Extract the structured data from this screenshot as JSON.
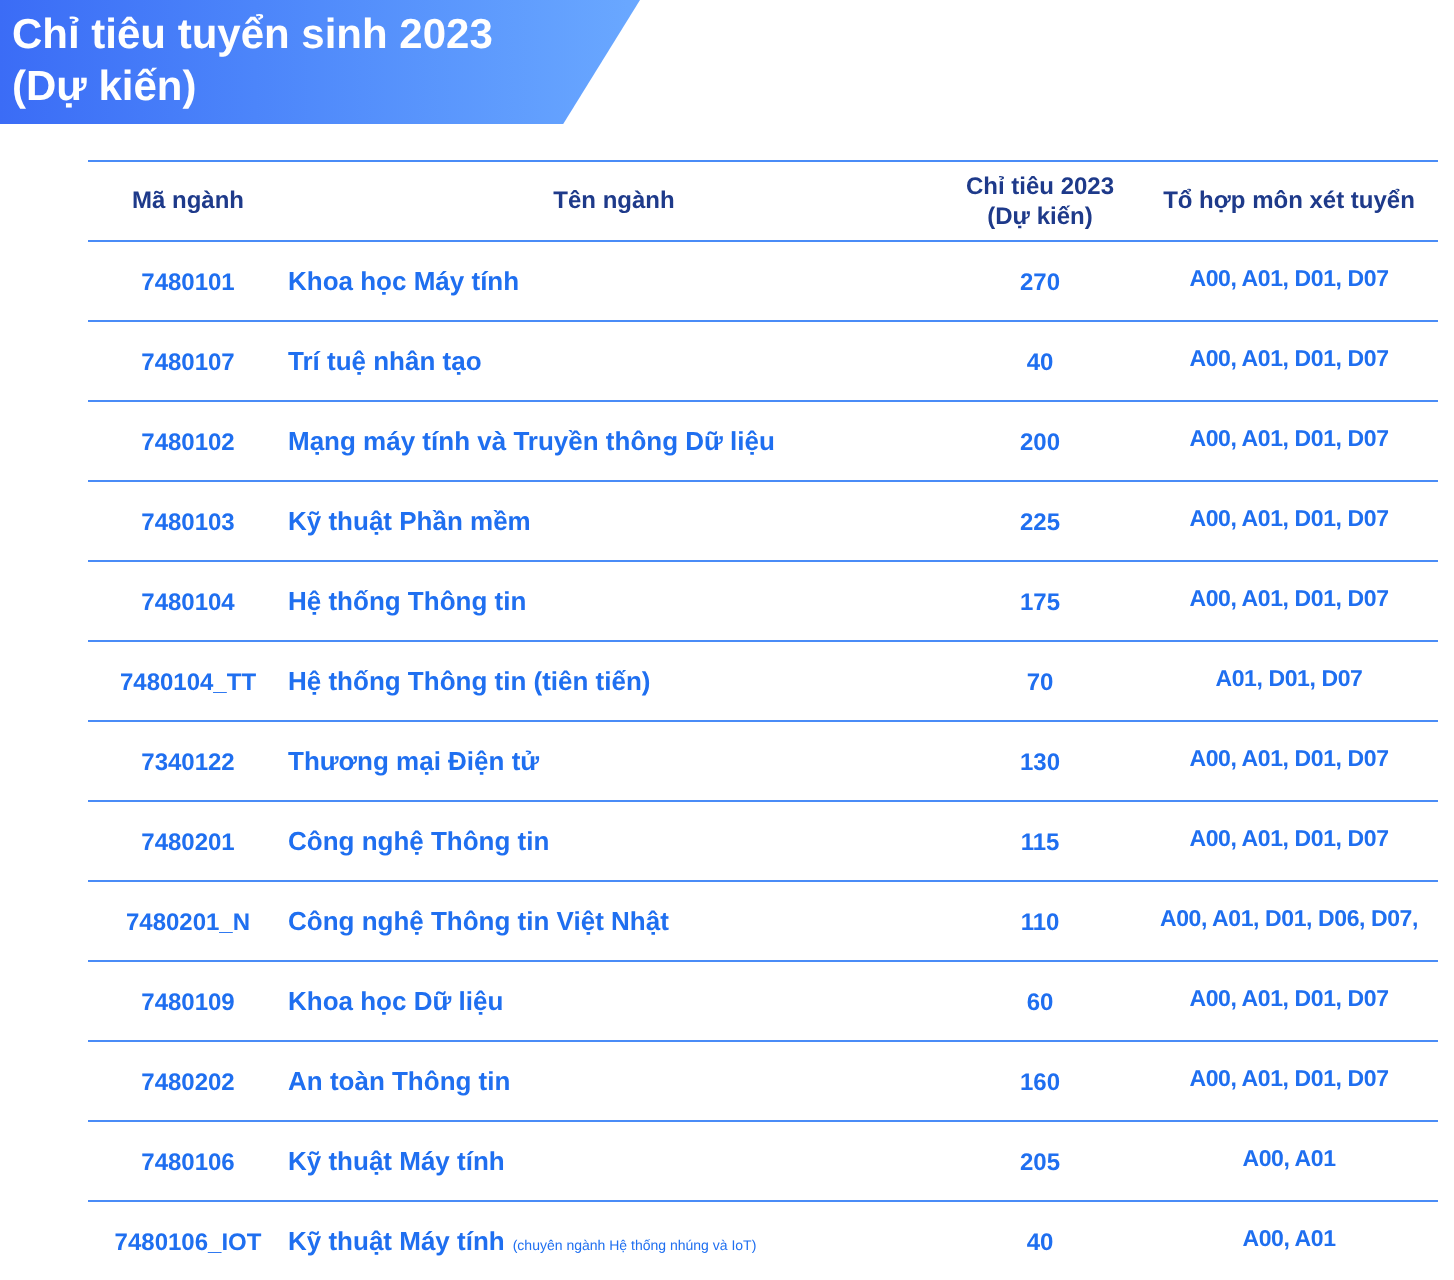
{
  "banner": {
    "title_lines": [
      "Chỉ tiêu tuyển sinh 2023",
      "(Dự kiến)"
    ]
  },
  "table": {
    "columns": [
      "Mã ngành",
      "Tên ngành",
      "Chỉ tiêu 2023\n(Dự kiến)",
      "Tổ hợp môn xét tuyển"
    ],
    "rows": [
      {
        "code": "7480101",
        "name": "Khoa học Máy tính",
        "quota": "270",
        "combos": "A00, A01, D01, D07"
      },
      {
        "code": "7480107",
        "name": "Trí tuệ nhân tạo",
        "quota": "40",
        "combos": "A00, A01, D01, D07"
      },
      {
        "code": "7480102",
        "name": "Mạng máy tính và Truyền thông Dữ liệu",
        "quota": "200",
        "combos": "A00, A01, D01, D07"
      },
      {
        "code": "7480103",
        "name": "Kỹ thuật Phần mềm",
        "quota": "225",
        "combos": "A00, A01, D01, D07"
      },
      {
        "code": "7480104",
        "name": "Hệ thống Thông tin",
        "quota": "175",
        "combos": "A00, A01, D01, D07"
      },
      {
        "code": "7480104_TT",
        "name": "Hệ thống Thông tin (tiên tiến)",
        "quota": "70",
        "combos": "A01, D01, D07"
      },
      {
        "code": "7340122",
        "name": "Thương mại Điện tử",
        "quota": "130",
        "combos": "A00, A01, D01, D07"
      },
      {
        "code": "7480201",
        "name": "Công nghệ Thông tin",
        "quota": "115",
        "combos": "A00, A01, D01, D07"
      },
      {
        "code": "7480201_N",
        "name": "Công nghệ Thông tin Việt Nhật",
        "quota": "110",
        "combos": "A00, A01, D01, D06, D07,"
      },
      {
        "code": "7480109",
        "name": "Khoa học Dữ liệu",
        "quota": "60",
        "combos": "A00, A01, D01, D07"
      },
      {
        "code": "7480202",
        "name": "An toàn Thông tin",
        "quota": "160",
        "combos": "A00, A01, D01, D07"
      },
      {
        "code": "7480106",
        "name": "Kỹ thuật Máy tính",
        "quota": "205",
        "combos": "A00, A01"
      },
      {
        "code": "7480106_IOT",
        "name": "Kỹ thuật Máy tính",
        "note": "(chuyên ngành Hệ thống nhúng và IoT)",
        "quota": "40",
        "combos": "A00, A01"
      }
    ]
  }
}
